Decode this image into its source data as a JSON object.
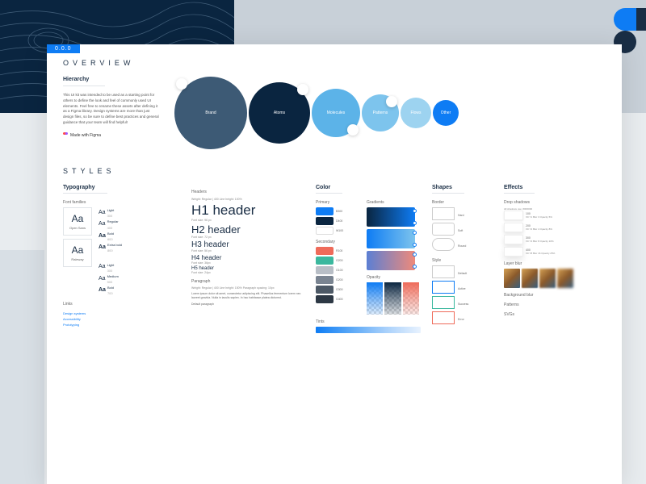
{
  "version": "0.0.0",
  "overview": {
    "title": "OVERVIEW",
    "hierarchy": {
      "title": "Hierarchy",
      "desc": "This UI kit was intended to be used as a starting point for others to define the look and feel of commonly used UI elements. Feel free to rename these assets after defining it as a Figma library. Design systems are more than just design files, so be sure to define best practices and general guidance that your team will find helpful!",
      "made": "Made with Figma"
    },
    "circles": [
      {
        "label": "Brand",
        "color": "#3d5a75",
        "size": 90,
        "dot": "tl"
      },
      {
        "label": "Atoms",
        "color": "#0a2540",
        "size": 76,
        "dot": "tr"
      },
      {
        "label": "Molecules",
        "color": "#5cb3e8",
        "size": 60,
        "dot": "br"
      },
      {
        "label": "Patterns",
        "color": "#7dc4ed",
        "size": 46,
        "dot": "tr"
      },
      {
        "label": "Flows",
        "color": "#9dd3f0",
        "size": 38,
        "dot": "none"
      },
      {
        "label": "Other",
        "color": "#0e7cf4",
        "size": 32,
        "dot": "none"
      }
    ]
  },
  "styles": {
    "title": "STYLES",
    "typography": {
      "title": "Typography",
      "families_label": "Font families",
      "families": [
        {
          "sample": "Aa",
          "name": "Open Sans"
        },
        {
          "sample": "Aa",
          "name": "Raleway"
        }
      ],
      "weights": [
        {
          "w": "300",
          "label": "Light"
        },
        {
          "w": "400",
          "label": "Regular"
        },
        {
          "w": "600",
          "label": "Bold"
        },
        {
          "w": "800",
          "label": "Extra bold"
        }
      ],
      "weights2": [
        {
          "w": "300",
          "label": "Light"
        },
        {
          "w": "500",
          "label": "Medium"
        },
        {
          "w": "700",
          "label": "Bold"
        }
      ],
      "headers_label": "Headers",
      "headers_meta": "Weight: Regular | 400    Line height: 100%",
      "h1": "H1 header",
      "h1m": "Font size: 96 px",
      "h2": "H2 header",
      "h2m": "Font size: 72 px",
      "h3": "H3 header",
      "h3m": "Font size: 56 px",
      "h4": "H4 header",
      "h4m": "Font size: 36px",
      "h5": "H5 header",
      "h5m": "Font size: 24px",
      "para_label": "Paragraph",
      "para_meta": "Weight: Regular | 400    Line height: 150%    Paragraph spacing: 10px",
      "para": "Lorem ipsum dolor sit amet, consectetur adipiscing elit. Phasellus fermentum lorem nec laoreet gravida. Nulla in iaculis sapien. In hac habitasse platea dictumst.",
      "para2": "Default paragraph",
      "links_label": "Links",
      "links": [
        "Design systems",
        "Accessibility",
        "Prototyping"
      ]
    },
    "color": {
      "title": "Color",
      "primary": "Primary",
      "primary_sw": [
        {
          "c": "#0e7cf4",
          "l": "B300"
        },
        {
          "c": "#0a2540",
          "l": "D400"
        },
        {
          "c": "#ffffff",
          "l": "W100"
        }
      ],
      "secondary": "Secondary",
      "secondary_sw": [
        {
          "c": "#ef6b5a",
          "l": "R100"
        },
        {
          "c": "#3bb89e",
          "l": "G200"
        },
        {
          "c": "#b8bec6",
          "l": "G100"
        },
        {
          "c": "#7a8491",
          "l": "G200"
        },
        {
          "c": "#4d5966",
          "l": "G300"
        },
        {
          "c": "#2d3844",
          "l": "G400"
        }
      ],
      "gradients": "Gradients",
      "gradient_colors": [
        "linear-gradient(90deg,#0a2540,#0e7cf4)",
        "linear-gradient(90deg,#0e7cf4,#7dc4ed)",
        "linear-gradient(90deg,#5b7fd4,#ef8a7a)"
      ],
      "opacity": "Opacity",
      "tints": "Tints"
    },
    "shapes": {
      "title": "Shapes",
      "border": "Border",
      "border_items": [
        "Hard",
        "Soft",
        "Round"
      ],
      "style": "Style",
      "style_items": [
        "Default",
        "Active",
        "Success",
        "Error"
      ]
    },
    "effects": {
      "title": "Effects",
      "drop": "Drop shadows",
      "drop_sub": "All shadows use: #000000",
      "drop_items": [
        {
          "l": "100",
          "m": "X0  Y1  Blur 3   Opacity 5%"
        },
        {
          "l": "200",
          "m": "X0  Y2  Blur 4   Opacity 8%"
        },
        {
          "l": "300",
          "m": "X0  Y4  Blur 8   Opacity 10%"
        },
        {
          "l": "400",
          "m": "X0  Y8  Blur 16  Opacity 25%"
        }
      ],
      "layer": "Layer blur",
      "bg": "Background blur",
      "patterns": "Patterns",
      "svgs": "SVGs"
    }
  }
}
